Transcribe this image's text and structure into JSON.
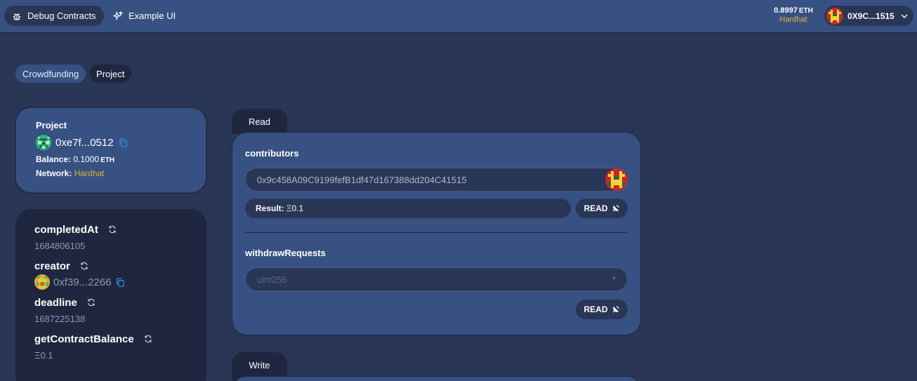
{
  "header": {
    "nav": [
      {
        "label": "Debug Contracts",
        "icon": "bug-icon"
      },
      {
        "label": "Example UI",
        "icon": "sparkles-icon"
      }
    ],
    "balance": {
      "amount": "0.8997",
      "unit": "ETH",
      "network": "Hardhat"
    },
    "account": {
      "address": "0X9C...1515"
    }
  },
  "contract_tabs": [
    "Crowdfunding",
    "Project"
  ],
  "contract": {
    "name": "Project",
    "address": "0xe7f...0512",
    "balance_label": "Balance:",
    "balance_value": "0.1000",
    "balance_unit": "ETH",
    "network_label": "Network:",
    "network_value": "Hardhat"
  },
  "variables": [
    {
      "name": "completedAt",
      "value": "1684806105"
    },
    {
      "name": "creator",
      "value": "0xf39...2266"
    },
    {
      "name": "deadline",
      "value": "1687225138"
    },
    {
      "name": "getContractBalance",
      "value": "Ξ0.1"
    }
  ],
  "panels": {
    "read_tab": "Read",
    "write_tab": "Write",
    "read_functions": {
      "contributors": {
        "name": "contributors",
        "input_value": "0x9c458A09C9199fefB1df47d167388dd204C41515",
        "result_label": "Result:",
        "result_value": "Ξ0.1",
        "button": "READ"
      },
      "withdrawRequests": {
        "name": "withdrawRequests",
        "placeholder": "uint256",
        "required_mark": "*",
        "button": "READ"
      }
    }
  },
  "colors": {
    "background": "#2a3655",
    "header": "#385183",
    "card": "#385183",
    "dark_card": "#1f2740",
    "accent_network": "#e0b53a",
    "copy_icon": "#2a8fd8"
  }
}
